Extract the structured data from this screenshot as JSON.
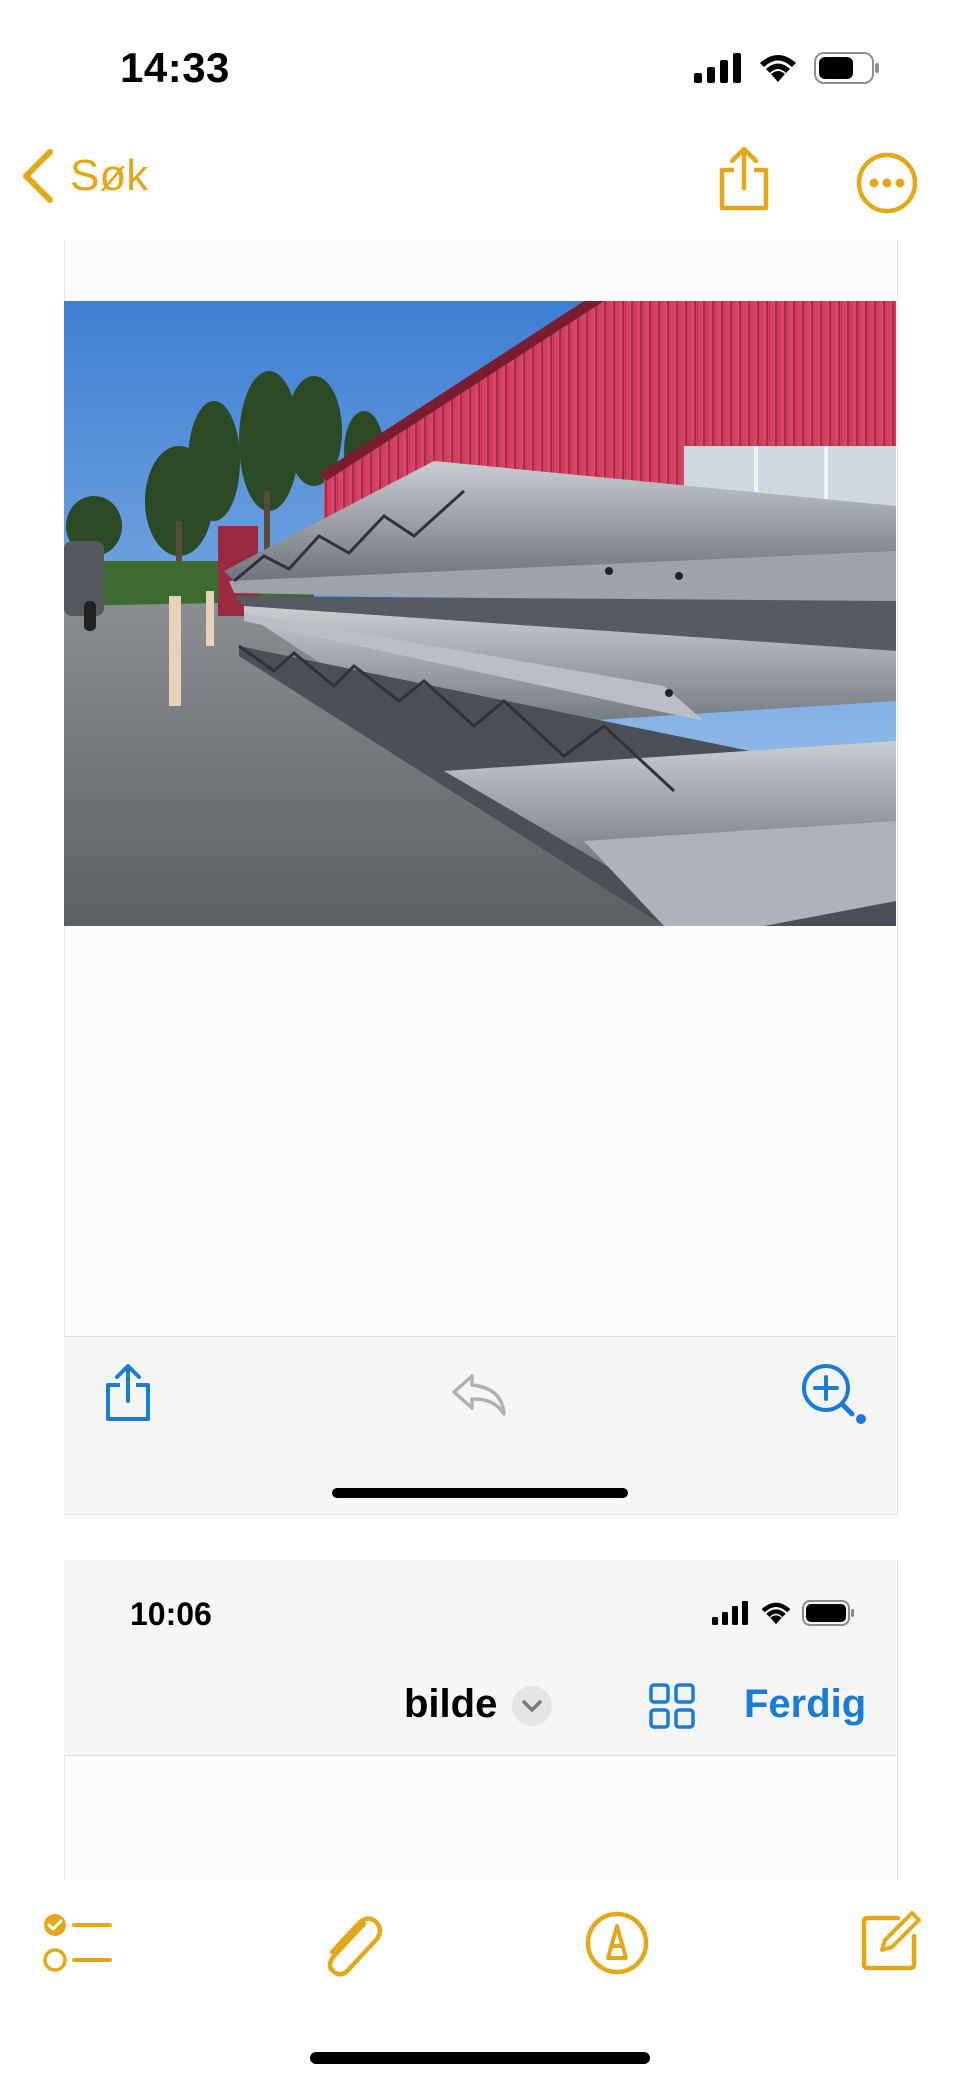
{
  "status_bar": {
    "time": "14:33",
    "battery": "battery-icon",
    "wifi": "wifi-icon",
    "signal": "signal-icon"
  },
  "nav": {
    "back_label": "Søk",
    "icons": [
      "chevron-left-icon",
      "share-icon",
      "more-icon"
    ],
    "accent": "#e3a81a"
  },
  "screenshot_1": {
    "photo": "corrugated-steel-sheets-stacked-beside-red-building",
    "toolbar_icons": [
      "share-icon",
      "reply-icon",
      "zoom-in-icon"
    ],
    "accent": "#1a7bd8"
  },
  "screenshot_2": {
    "time": "10:06",
    "title": "bilde",
    "done_label": "Ferdig",
    "icons": [
      "chevron-down-icon",
      "grid-icon"
    ]
  },
  "bottom_toolbar": {
    "icons": [
      "checklist-icon",
      "paperclip-icon",
      "markup-pen-icon",
      "compose-icon"
    ]
  }
}
